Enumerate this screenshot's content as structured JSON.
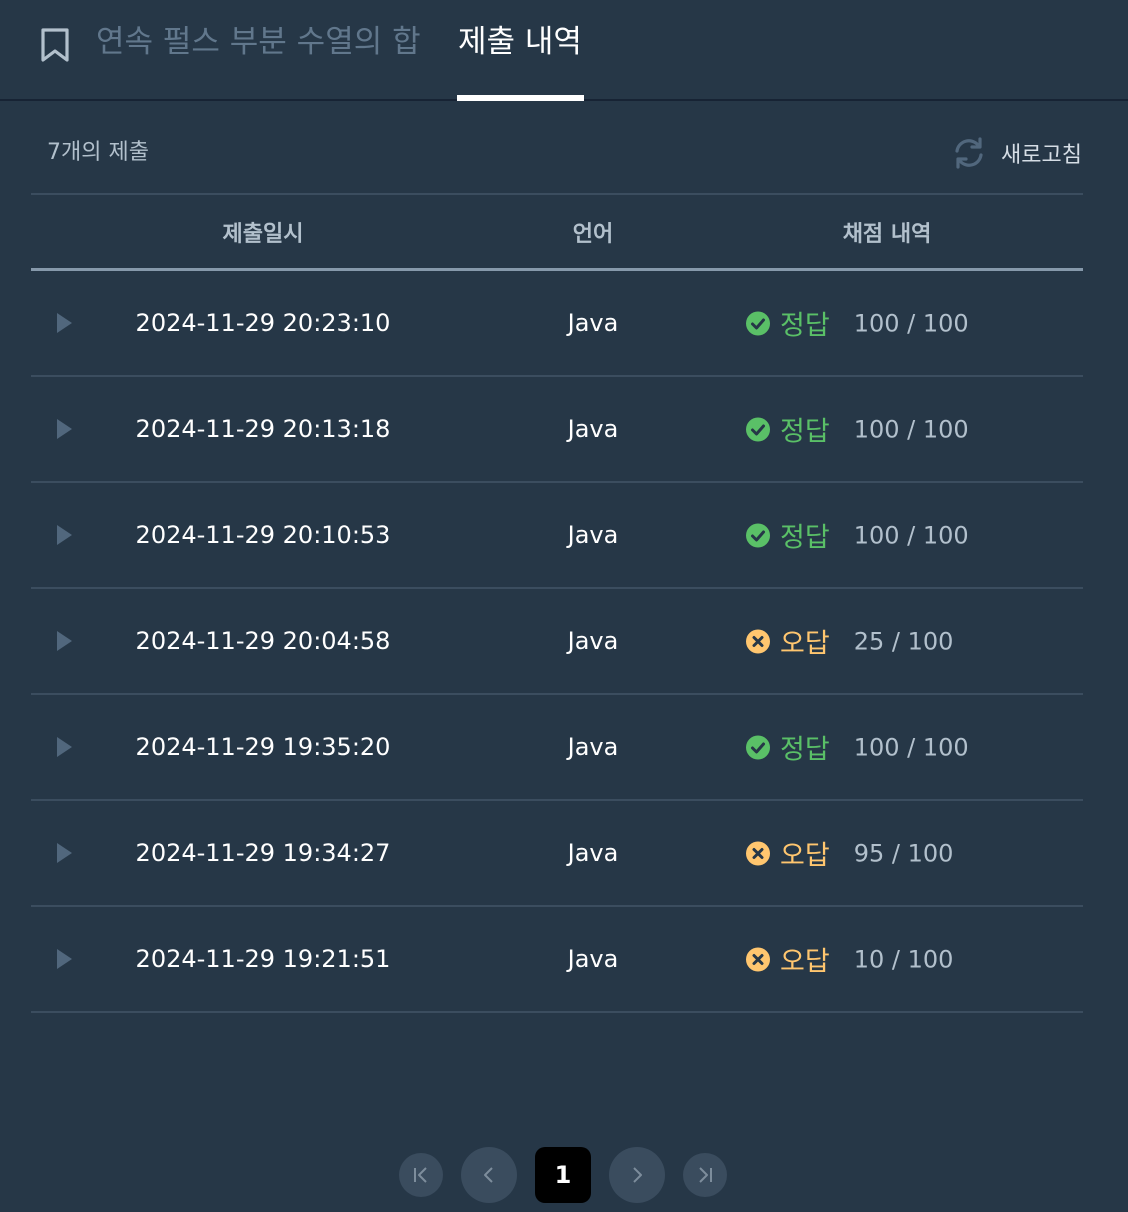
{
  "tabs": {
    "problem_title": "연속 펄스 부분 수열의 합",
    "submissions": "제출 내역"
  },
  "toolbar": {
    "count_label": "7개의 제출",
    "refresh_label": "새로고침"
  },
  "table": {
    "headers": {
      "date": "제출일시",
      "language": "언어",
      "result": "채점 내역"
    },
    "rows": [
      {
        "date": "2024-11-29 20:23:10",
        "language": "Java",
        "status": "정답",
        "correct": true,
        "score": "100 / 100"
      },
      {
        "date": "2024-11-29 20:13:18",
        "language": "Java",
        "status": "정답",
        "correct": true,
        "score": "100 / 100"
      },
      {
        "date": "2024-11-29 20:10:53",
        "language": "Java",
        "status": "정답",
        "correct": true,
        "score": "100 / 100"
      },
      {
        "date": "2024-11-29 20:04:58",
        "language": "Java",
        "status": "오답",
        "correct": false,
        "score": "25 / 100"
      },
      {
        "date": "2024-11-29 19:35:20",
        "language": "Java",
        "status": "정답",
        "correct": true,
        "score": "100 / 100"
      },
      {
        "date": "2024-11-29 19:34:27",
        "language": "Java",
        "status": "오답",
        "correct": false,
        "score": "95 / 100"
      },
      {
        "date": "2024-11-29 19:21:51",
        "language": "Java",
        "status": "오답",
        "correct": false,
        "score": "10 / 100"
      }
    ]
  },
  "pagination": {
    "current_page": "1",
    "icons": [
      "first-page-icon",
      "prev-page-icon",
      "next-page-icon",
      "last-page-icon"
    ]
  },
  "colors": {
    "background": "#263747",
    "correct": "#5ac067",
    "wrong": "#ffc66f",
    "muted": "#b2c0cc"
  }
}
